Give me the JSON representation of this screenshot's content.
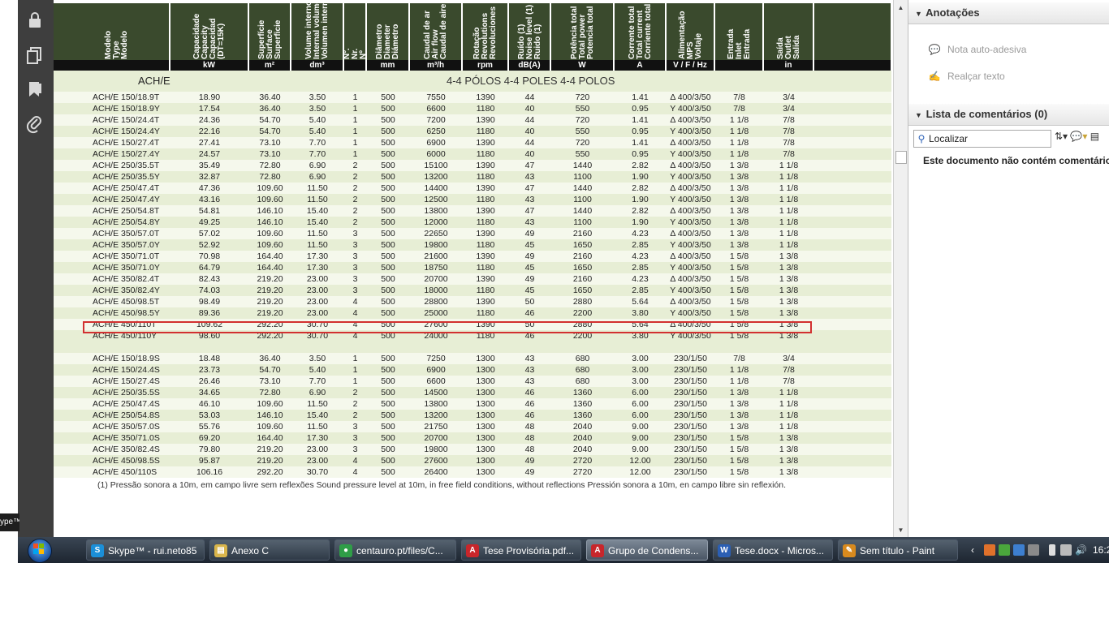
{
  "left_toolbar": {
    "icons": [
      "lock-icon",
      "pages-icon",
      "bookmark-icon",
      "attachment-icon"
    ]
  },
  "table": {
    "headers": [
      {
        "lines": [
          "Modelo",
          "Type",
          "Modelo"
        ],
        "unit": ""
      },
      {
        "lines": [
          "Capacidade",
          "Capacity",
          "Capacidad",
          "(DT=15K)"
        ],
        "unit": "kW"
      },
      {
        "lines": [
          "Superfície",
          "Surface",
          "Superficie"
        ],
        "unit": "m²"
      },
      {
        "lines": [
          "Volume interno",
          "Internal volume",
          "Volumen interno"
        ],
        "unit": "dm³"
      },
      {
        "lines": [
          "Nº.",
          "Nr.",
          "Nº"
        ],
        "unit": ""
      },
      {
        "lines": [
          "Diâmetro",
          "Diameter",
          "Diámetro"
        ],
        "unit": "mm"
      },
      {
        "lines": [
          "Caudal de ar",
          "Air flow",
          "Caudal de aire"
        ],
        "unit": "m³/h"
      },
      {
        "lines": [
          "Rotação",
          "Revolutions",
          "Revoluciones"
        ],
        "unit": "rpm"
      },
      {
        "lines": [
          "Ruído (1)",
          "Noise level (1)",
          "Ruido (1)"
        ],
        "unit": "dB(A)"
      },
      {
        "lines": [
          "Potência total",
          "Total power",
          "Potencia total"
        ],
        "unit": "W"
      },
      {
        "lines": [
          "Corrente total",
          "Total current",
          "Corriente total"
        ],
        "unit": "A"
      },
      {
        "lines": [
          "Alimentação",
          "MPS",
          "Voltaje"
        ],
        "unit": "V / F / Hz"
      },
      {
        "lines": [
          "Entrada",
          "Inlet",
          "Entrada"
        ],
        "unit": ""
      },
      {
        "lines": [
          "Saída",
          "Outlet",
          "Salida"
        ],
        "unit": "in"
      }
    ],
    "section_label": "ACH/E",
    "poles_label": "4-4 PÓLOS  4-4 POLES  4-4 POLOS",
    "rows_group1": [
      [
        "ACH/E  150/18.9T",
        "18.90",
        "36.40",
        "3.50",
        "1",
        "500",
        "7550",
        "1390",
        "44",
        "720",
        "1.41",
        "Δ 400/3/50",
        "7/8",
        "3/4"
      ],
      [
        "ACH/E  150/18.9Y",
        "17.54",
        "36.40",
        "3.50",
        "1",
        "500",
        "6600",
        "1180",
        "40",
        "550",
        "0.95",
        "Y 400/3/50",
        "7/8",
        "3/4"
      ],
      [
        "ACH/E  150/24.4T",
        "24.36",
        "54.70",
        "5.40",
        "1",
        "500",
        "7200",
        "1390",
        "44",
        "720",
        "1.41",
        "Δ 400/3/50",
        "1 1/8",
        "7/8"
      ],
      [
        "ACH/E  150/24.4Y",
        "22.16",
        "54.70",
        "5.40",
        "1",
        "500",
        "6250",
        "1180",
        "40",
        "550",
        "0.95",
        "Y 400/3/50",
        "1 1/8",
        "7/8"
      ],
      [
        "ACH/E  150/27.4T",
        "27.41",
        "73.10",
        "7.70",
        "1",
        "500",
        "6900",
        "1390",
        "44",
        "720",
        "1.41",
        "Δ 400/3/50",
        "1 1/8",
        "7/8"
      ],
      [
        "ACH/E  150/27.4Y",
        "24.57",
        "73.10",
        "7.70",
        "1",
        "500",
        "6000",
        "1180",
        "40",
        "550",
        "0.95",
        "Y 400/3/50",
        "1 1/8",
        "7/8"
      ],
      [
        "ACH/E  250/35.5T",
        "35.49",
        "72.80",
        "6.90",
        "2",
        "500",
        "15100",
        "1390",
        "47",
        "1440",
        "2.82",
        "Δ 400/3/50",
        "1 3/8",
        "1 1/8"
      ],
      [
        "ACH/E  250/35.5Y",
        "32.87",
        "72.80",
        "6.90",
        "2",
        "500",
        "13200",
        "1180",
        "43",
        "1100",
        "1.90",
        "Y 400/3/50",
        "1 3/8",
        "1 1/8"
      ],
      [
        "ACH/E  250/47.4T",
        "47.36",
        "109.60",
        "11.50",
        "2",
        "500",
        "14400",
        "1390",
        "47",
        "1440",
        "2.82",
        "Δ 400/3/50",
        "1 3/8",
        "1 1/8"
      ],
      [
        "ACH/E  250/47.4Y",
        "43.16",
        "109.60",
        "11.50",
        "2",
        "500",
        "12500",
        "1180",
        "43",
        "1100",
        "1.90",
        "Y 400/3/50",
        "1 3/8",
        "1 1/8"
      ],
      [
        "ACH/E  250/54.8T",
        "54.81",
        "146.10",
        "15.40",
        "2",
        "500",
        "13800",
        "1390",
        "47",
        "1440",
        "2.82",
        "Δ 400/3/50",
        "1 3/8",
        "1 1/8"
      ],
      [
        "ACH/E  250/54.8Y",
        "49.25",
        "146.10",
        "15.40",
        "2",
        "500",
        "12000",
        "1180",
        "43",
        "1100",
        "1.90",
        "Y 400/3/50",
        "1 3/8",
        "1 1/8"
      ],
      [
        "ACH/E  350/57.0T",
        "57.02",
        "109.60",
        "11.50",
        "3",
        "500",
        "22650",
        "1390",
        "49",
        "2160",
        "4.23",
        "Δ 400/3/50",
        "1 3/8",
        "1 1/8"
      ],
      [
        "ACH/E  350/57.0Y",
        "52.92",
        "109.60",
        "11.50",
        "3",
        "500",
        "19800",
        "1180",
        "45",
        "1650",
        "2.85",
        "Y 400/3/50",
        "1 3/8",
        "1 1/8"
      ],
      [
        "ACH/E  350/71.0T",
        "70.98",
        "164.40",
        "17.30",
        "3",
        "500",
        "21600",
        "1390",
        "49",
        "2160",
        "4.23",
        "Δ 400/3/50",
        "1 5/8",
        "1 3/8"
      ],
      [
        "ACH/E  350/71.0Y",
        "64.79",
        "164.40",
        "17.30",
        "3",
        "500",
        "18750",
        "1180",
        "45",
        "1650",
        "2.85",
        "Y 400/3/50",
        "1 5/8",
        "1 3/8"
      ],
      [
        "ACH/E  350/82.4T",
        "82.43",
        "219.20",
        "23.00",
        "3",
        "500",
        "20700",
        "1390",
        "49",
        "2160",
        "4.23",
        "Δ 400/3/50",
        "1 5/8",
        "1 3/8"
      ],
      [
        "ACH/E  350/82.4Y",
        "74.03",
        "219.20",
        "23.00",
        "3",
        "500",
        "18000",
        "1180",
        "45",
        "1650",
        "2.85",
        "Y 400/3/50",
        "1 5/8",
        "1 3/8"
      ],
      [
        "ACH/E  450/98.5T",
        "98.49",
        "219.20",
        "23.00",
        "4",
        "500",
        "28800",
        "1390",
        "50",
        "2880",
        "5.64",
        "Δ 400/3/50",
        "1 5/8",
        "1 3/8"
      ],
      [
        "ACH/E  450/98.5Y",
        "89.36",
        "219.20",
        "23.00",
        "4",
        "500",
        "25000",
        "1180",
        "46",
        "2200",
        "3.80",
        "Y 400/3/50",
        "1 5/8",
        "1 3/8"
      ],
      [
        "ACH/E  450/110T",
        "109.62",
        "292.20",
        "30.70",
        "4",
        "500",
        "27600",
        "1390",
        "50",
        "2880",
        "5.64",
        "Δ 400/3/50",
        "1 5/8",
        "1 3/8"
      ],
      [
        "ACH/E  450/110Y",
        "98.60",
        "292.20",
        "30.70",
        "4",
        "500",
        "24000",
        "1180",
        "46",
        "2200",
        "3.80",
        "Y 400/3/50",
        "1 5/8",
        "1 3/8"
      ]
    ],
    "rows_group2": [
      [
        "ACH/E  150/18.9S",
        "18.48",
        "36.40",
        "3.50",
        "1",
        "500",
        "7250",
        "1300",
        "43",
        "680",
        "3.00",
        "230/1/50",
        "7/8",
        "3/4"
      ],
      [
        "ACH/E  150/24.4S",
        "23.73",
        "54.70",
        "5.40",
        "1",
        "500",
        "6900",
        "1300",
        "43",
        "680",
        "3.00",
        "230/1/50",
        "1 1/8",
        "7/8"
      ],
      [
        "ACH/E  150/27.4S",
        "26.46",
        "73.10",
        "7.70",
        "1",
        "500",
        "6600",
        "1300",
        "43",
        "680",
        "3.00",
        "230/1/50",
        "1 1/8",
        "7/8"
      ],
      [
        "ACH/E  250/35.5S",
        "34.65",
        "72.80",
        "6.90",
        "2",
        "500",
        "14500",
        "1300",
        "46",
        "1360",
        "6.00",
        "230/1/50",
        "1 3/8",
        "1 1/8"
      ],
      [
        "ACH/E  250/47.4S",
        "46.10",
        "109.60",
        "11.50",
        "2",
        "500",
        "13800",
        "1300",
        "46",
        "1360",
        "6.00",
        "230/1/50",
        "1 3/8",
        "1 1/8"
      ],
      [
        "ACH/E  250/54.8S",
        "53.03",
        "146.10",
        "15.40",
        "2",
        "500",
        "13200",
        "1300",
        "46",
        "1360",
        "6.00",
        "230/1/50",
        "1 3/8",
        "1 1/8"
      ],
      [
        "ACH/E  350/57.0S",
        "55.76",
        "109.60",
        "11.50",
        "3",
        "500",
        "21750",
        "1300",
        "48",
        "2040",
        "9.00",
        "230/1/50",
        "1 3/8",
        "1 1/8"
      ],
      [
        "ACH/E  350/71.0S",
        "69.20",
        "164.40",
        "17.30",
        "3",
        "500",
        "20700",
        "1300",
        "48",
        "2040",
        "9.00",
        "230/1/50",
        "1 5/8",
        "1 3/8"
      ],
      [
        "ACH/E  350/82.4S",
        "79.80",
        "219.20",
        "23.00",
        "3",
        "500",
        "19800",
        "1300",
        "48",
        "2040",
        "9.00",
        "230/1/50",
        "1 5/8",
        "1 3/8"
      ],
      [
        "ACH/E  450/98.5S",
        "95.87",
        "219.20",
        "23.00",
        "4",
        "500",
        "27600",
        "1300",
        "49",
        "2720",
        "12.00",
        "230/1/50",
        "1 5/8",
        "1 3/8"
      ],
      [
        "ACH/E  450/110S",
        "106.16",
        "292.20",
        "30.70",
        "4",
        "500",
        "26400",
        "1300",
        "49",
        "2720",
        "12.00",
        "230/1/50",
        "1 5/8",
        "1 3/8"
      ]
    ],
    "footnote": "(1) Pressão sonora a 10m, em campo livre sem reflexões    Sound pressure level at 10m, in free field conditions, without reflections    Pressión sonora a 10m, en campo libre sin reflexión."
  },
  "right_panel": {
    "annotations_title": "Anotações",
    "sticky_note": "Nota auto-adesiva",
    "highlight_text": "Realçar texto",
    "comments_title": "Lista de comentários (0)",
    "search_placeholder": "Localizar",
    "no_comments": "Este documento não contém comentários"
  },
  "skype_floating": "ype™",
  "taskbar": {
    "items": [
      {
        "label": "Skype™ - rui.neto85",
        "icon": "skype-icon",
        "color": "#1b8fd8",
        "glyph": "S"
      },
      {
        "label": "Anexo C",
        "icon": "folder-icon",
        "color": "#d9b54b",
        "glyph": "▤"
      },
      {
        "label": "centauro.pt/files/C...",
        "icon": "chrome-icon",
        "color": "#2f9e47",
        "glyph": "●"
      },
      {
        "label": "Tese Provisória.pdf...",
        "icon": "pdf-icon",
        "color": "#c8262b",
        "glyph": "A"
      },
      {
        "label": "Grupo de Condens...",
        "icon": "pdf-icon",
        "color": "#c8262b",
        "glyph": "A"
      },
      {
        "label": "Tese.docx - Micros...",
        "icon": "word-icon",
        "color": "#2b5fb4",
        "glyph": "W"
      },
      {
        "label": "Sem título - Paint",
        "icon": "paint-icon",
        "color": "#d88a1e",
        "glyph": "✎"
      }
    ],
    "active_index": 4,
    "clock": "16:2"
  }
}
